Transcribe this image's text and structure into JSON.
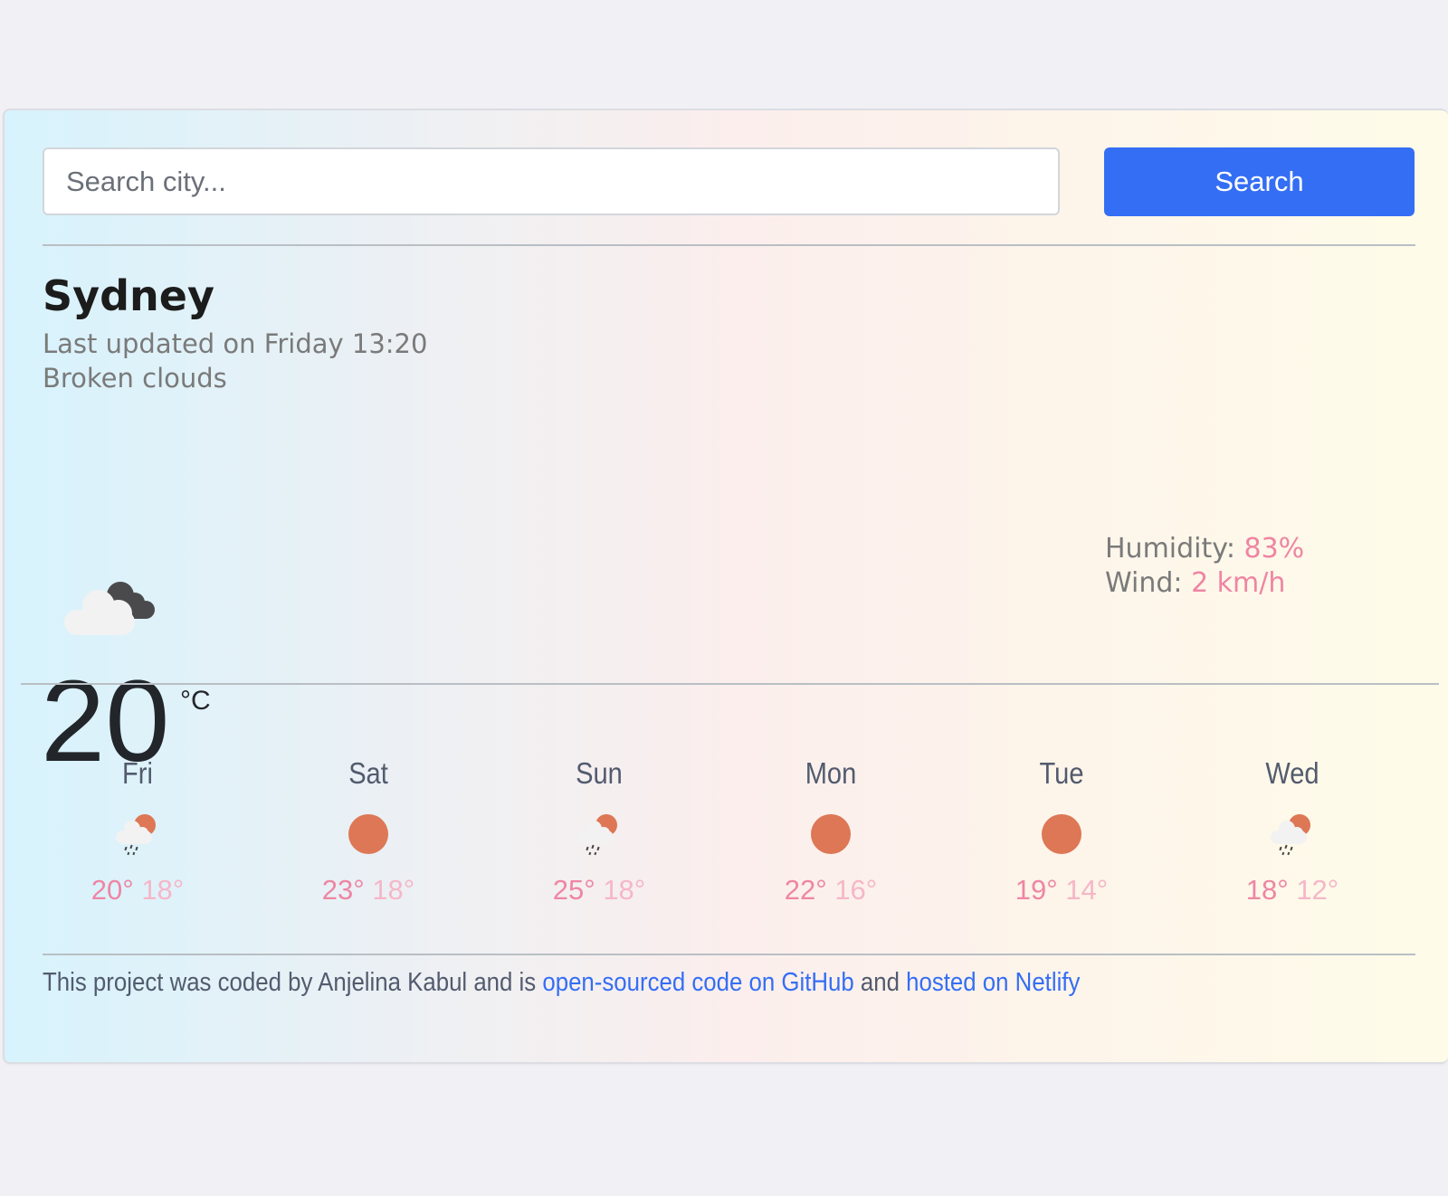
{
  "search": {
    "placeholder": "Search city...",
    "value": "",
    "button_label": "Search"
  },
  "current": {
    "city": "Sydney",
    "last_updated": "Last updated on Friday 13:20",
    "description": "Broken clouds",
    "icon": "broken-clouds-icon",
    "temperature": "20",
    "unit": "°C",
    "humidity_label": "Humidity:",
    "humidity_value": "83%",
    "wind_label": "Wind:",
    "wind_value": "2 km/h"
  },
  "forecast": [
    {
      "day": "Fri",
      "icon": "sun-rain-cloud-icon",
      "max": "20°",
      "min": "18°"
    },
    {
      "day": "Sat",
      "icon": "sun-icon",
      "max": "23°",
      "min": "18°"
    },
    {
      "day": "Sun",
      "icon": "sun-rain-cloud-icon",
      "max": "25°",
      "min": "18°"
    },
    {
      "day": "Mon",
      "icon": "sun-icon",
      "max": "22°",
      "min": "16°"
    },
    {
      "day": "Tue",
      "icon": "sun-icon",
      "max": "19°",
      "min": "14°"
    },
    {
      "day": "Wed",
      "icon": "sun-rain-cloud-icon",
      "max": "18°",
      "min": "12°"
    }
  ],
  "footer": {
    "text_before": "This project was coded by Anjelina Kabul and is ",
    "github_link": "open-sourced code on GitHub",
    "text_middle": " and ",
    "netlify_link": "hosted on Netlify"
  },
  "colors": {
    "accent": "#346ef4",
    "highlight": "#ef85a3",
    "sun": "#dd7755"
  }
}
